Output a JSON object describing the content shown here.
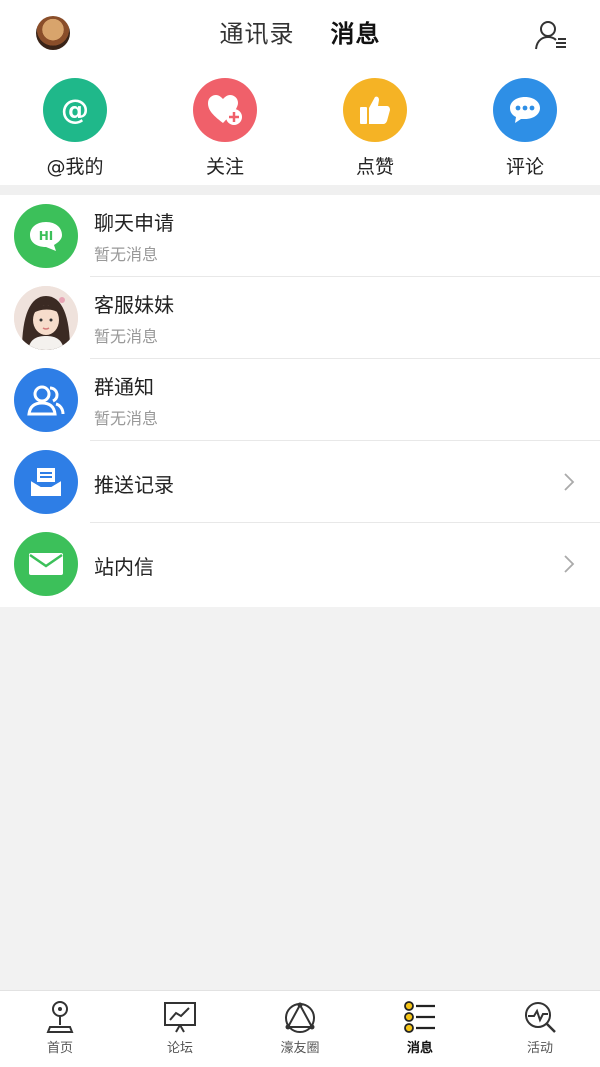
{
  "header": {
    "tabs": [
      {
        "label": "通讯录",
        "active": false
      },
      {
        "label": "消息",
        "active": true
      }
    ]
  },
  "quick_actions": [
    {
      "label": "@我的",
      "icon": "at-icon",
      "color": "#1fb88a"
    },
    {
      "label": "关注",
      "icon": "heart-plus-icon",
      "color": "#f0606a"
    },
    {
      "label": "点赞",
      "icon": "thumbs-up-icon",
      "color": "#f5b325"
    },
    {
      "label": "评论",
      "icon": "chat-bubble-icon",
      "color": "#2e8fe6"
    }
  ],
  "list": [
    {
      "title": "聊天申请",
      "subtitle": "暂无消息",
      "icon": "hi-bubble-icon",
      "color": "#3cc05a"
    },
    {
      "title": "客服妹妹",
      "subtitle": "暂无消息",
      "icon": "support-avatar"
    },
    {
      "title": "群通知",
      "subtitle": "暂无消息",
      "icon": "group-icon",
      "color": "#2e7ee6"
    },
    {
      "title": "推送记录",
      "icon": "inbox-icon",
      "color": "#2e7ee6"
    },
    {
      "title": "站内信",
      "icon": "envelope-icon",
      "color": "#3cc05a"
    }
  ],
  "bottom_nav": [
    {
      "label": "首页",
      "icon": "home-joystick-icon",
      "active": false
    },
    {
      "label": "论坛",
      "icon": "forum-chart-icon",
      "active": false
    },
    {
      "label": "濠友圈",
      "icon": "triangle-network-icon",
      "active": false
    },
    {
      "label": "消息",
      "icon": "message-list-icon",
      "active": true
    },
    {
      "label": "活动",
      "icon": "activity-search-icon",
      "active": false
    }
  ]
}
